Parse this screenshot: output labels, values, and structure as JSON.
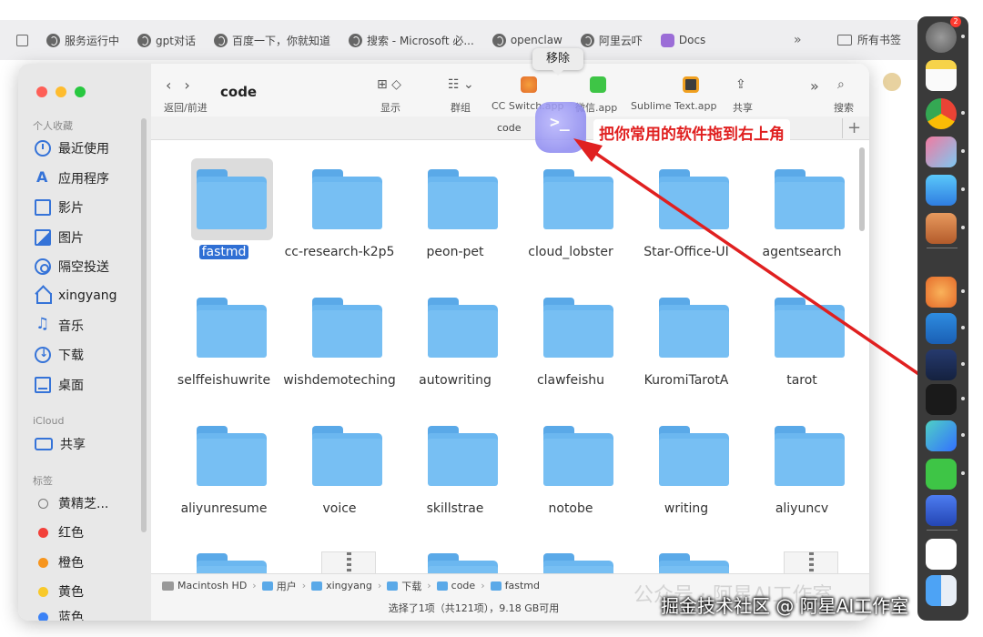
{
  "bookmarks": {
    "items": [
      "服务运行中",
      "gpt对话",
      "百度一下，你就知道",
      "搜索 - Microsoft 必...",
      "openclaw",
      "阿里云吓",
      "Docs"
    ],
    "overflow": "»",
    "all_label": "所有书签"
  },
  "sidebar": {
    "favorites_title": "个人收藏",
    "favorites": [
      "最近使用",
      "应用程序",
      "影片",
      "图片",
      "隔空投送",
      "xingyang",
      "音乐",
      "下载",
      "桌面"
    ],
    "icloud_title": "iCloud",
    "icloud": [
      "共享"
    ],
    "tags_title": "标签",
    "tags": [
      {
        "label": "黄精芝...",
        "color": ""
      },
      {
        "label": "红色",
        "color": "#f2403a"
      },
      {
        "label": "橙色",
        "color": "#f7951d"
      },
      {
        "label": "黄色",
        "color": "#f8c92a"
      },
      {
        "label": "蓝色",
        "color": "#3b82f6"
      }
    ]
  },
  "toolbar": {
    "nav_label": "返回/前进",
    "title": "code",
    "view_label": "显示",
    "group_label": "群组",
    "apps": [
      "CC Switch.app",
      "微信.app",
      "Sublime Text.app"
    ],
    "share_label": "共享",
    "search_label": "搜索",
    "overflow": "»"
  },
  "path_label": "code",
  "tooltip": "移除",
  "annotation": "把你常用的软件拖到右上角",
  "folders": [
    "fastmd",
    "cc-research-k2p5",
    "peon-pet",
    "cloud_lobster",
    "Star-Office-UI",
    "agentsearch",
    "selffeishuwrite",
    "wishdemoteching",
    "autowriting",
    "clawfeishu",
    "KuromiTarotA",
    "tarot",
    "aliyunresume",
    "voice",
    "skillstrae",
    "notobe",
    "writing",
    "aliyuncv"
  ],
  "selected_folder": "fastmd",
  "pathbar": [
    "Macintosh HD",
    "用户",
    "xingyang",
    "下载",
    "code",
    "fastmd"
  ],
  "status": "选择了1项（共121项），9.18 GB可用",
  "dock_badge": "2",
  "watermark": "公众号 · 阿星AI工作室",
  "credit": "掘金技术社区 @ 阿星AI工作室",
  "colors": {
    "folder": "#6bb7f0",
    "selection": "#2f6fd4",
    "arrow": "#e02020"
  }
}
